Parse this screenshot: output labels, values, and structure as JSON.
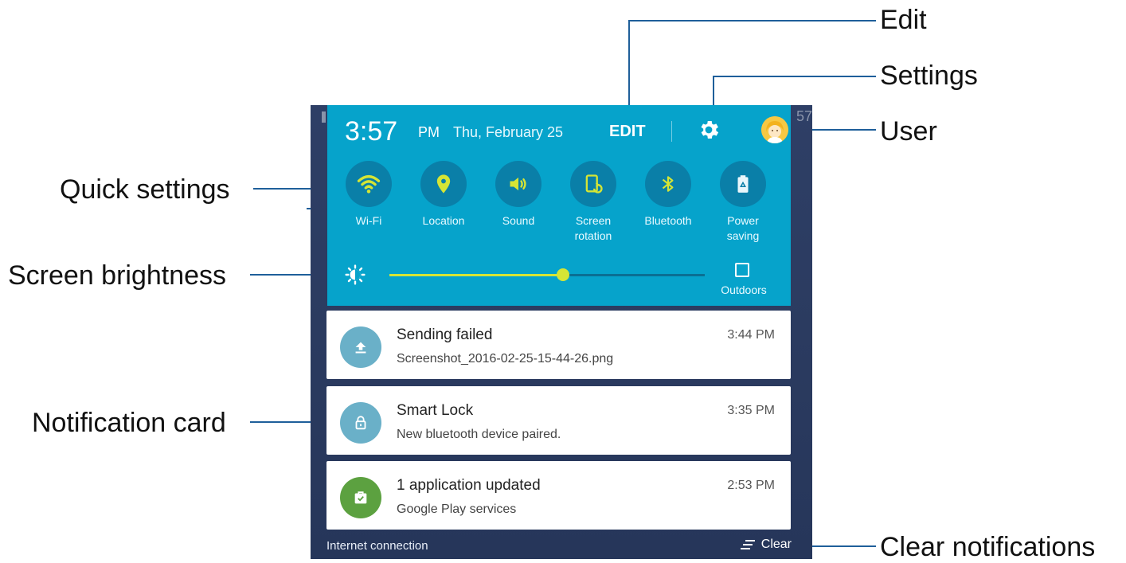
{
  "callouts": {
    "edit": "Edit",
    "settings": "Settings",
    "user": "User",
    "quick_settings": "Quick settings",
    "screen_brightness": "Screen brightness",
    "notification_card": "Notification card",
    "clear_notifications": "Clear notifications"
  },
  "header": {
    "time": "3:57",
    "ampm": "PM",
    "date": "Thu, February 25",
    "edit_label": "EDIT",
    "edge_digits": "57"
  },
  "quick_settings": [
    {
      "label": "Wi-Fi",
      "icon": "wifi-icon",
      "active": true
    },
    {
      "label": "Location",
      "icon": "location-pin-icon",
      "active": true
    },
    {
      "label": "Sound",
      "icon": "speaker-icon",
      "active": true
    },
    {
      "label": "Screen rotation",
      "icon": "screen-rotation-icon",
      "active": true
    },
    {
      "label": "Bluetooth",
      "icon": "bluetooth-icon",
      "active": true
    },
    {
      "label": "Power saving",
      "icon": "battery-recycle-icon",
      "active": false
    }
  ],
  "brightness": {
    "level": 0.55,
    "outdoors_label": "Outdoors"
  },
  "notifications": [
    {
      "title": "Sending failed",
      "text": "Screenshot_2016-02-25-15-44-26.png",
      "time": "3:44 PM",
      "icon": "upload-icon",
      "color": "#6ab0c8"
    },
    {
      "title": "Smart Lock",
      "text": "New bluetooth device paired.",
      "time": "3:35 PM",
      "icon": "lock-icon",
      "color": "#6ab0c8"
    },
    {
      "title": "1 application updated",
      "text": "Google Play services",
      "time": "2:53 PM",
      "icon": "briefcase-check-icon",
      "color": "#5ca140"
    }
  ],
  "footer": {
    "status": "Internet connection",
    "clear_label": "Clear"
  },
  "colors": {
    "panel": "#06a3cb",
    "icon_bg": "#0a7fa8",
    "accent": "#d5e535",
    "leader": "#1f5f9a"
  }
}
